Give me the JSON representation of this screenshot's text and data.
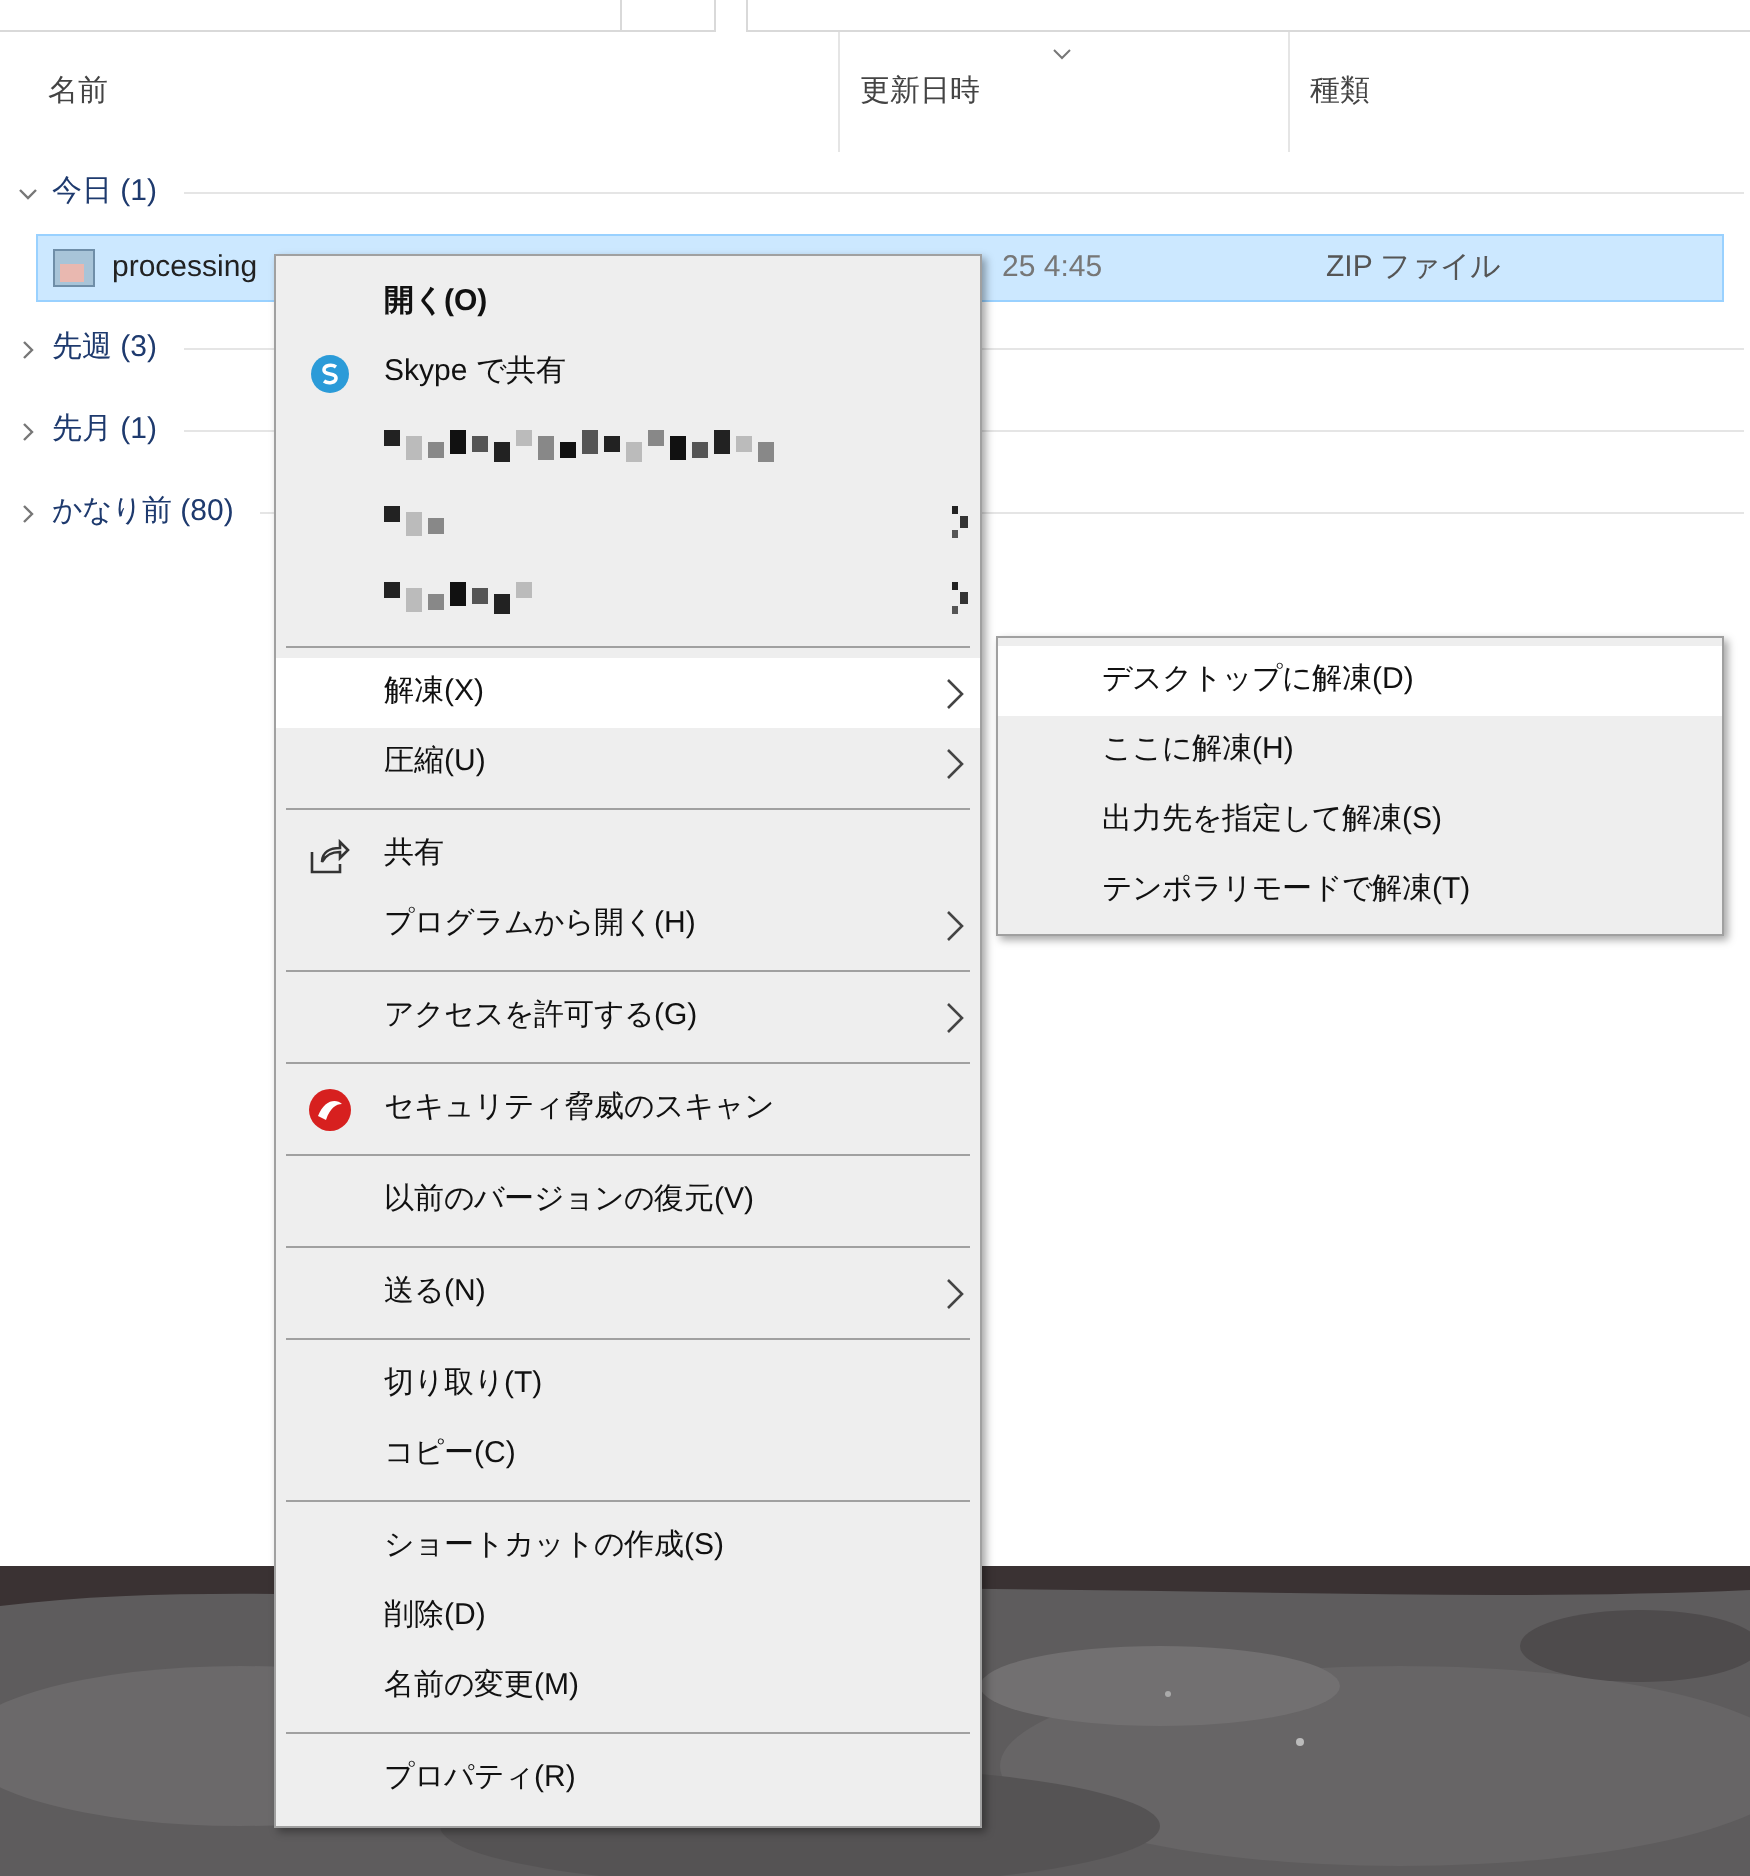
{
  "columns": [
    {
      "label": "名前",
      "sorted": false
    },
    {
      "label": "更新日時",
      "sorted": true
    },
    {
      "label": "種類",
      "sorted": false
    }
  ],
  "groups": [
    {
      "label": "今日 (1)",
      "expanded": true,
      "files": [
        {
          "name": "processing",
          "date": "25 4:45",
          "type": "ZIP ファイル",
          "selected": true
        }
      ]
    },
    {
      "label": "先週 (3)",
      "expanded": false
    },
    {
      "label": "先月 (1)",
      "expanded": false
    },
    {
      "label": "かなり前 (80)",
      "expanded": false
    }
  ],
  "context_menu": [
    {
      "kind": "item",
      "label": "開く(O)",
      "bold": true,
      "submenu": false,
      "selected": false
    },
    {
      "kind": "skype",
      "label": "Skype で共有",
      "submenu": false,
      "selected": false
    },
    {
      "kind": "redacted",
      "submenu": false
    },
    {
      "kind": "redacted",
      "submenu": true
    },
    {
      "kind": "redacted",
      "submenu": true
    },
    {
      "kind": "separator"
    },
    {
      "kind": "item",
      "label": "解凍(X)",
      "submenu": true,
      "selected": true
    },
    {
      "kind": "item",
      "label": "圧縮(U)",
      "submenu": true,
      "selected": false
    },
    {
      "kind": "separator"
    },
    {
      "kind": "share",
      "label": "共有",
      "submenu": false,
      "selected": false
    },
    {
      "kind": "item",
      "label": "プログラムから開く(H)",
      "submenu": true,
      "selected": false
    },
    {
      "kind": "separator"
    },
    {
      "kind": "item",
      "label": "アクセスを許可する(G)",
      "submenu": true,
      "selected": false
    },
    {
      "kind": "separator"
    },
    {
      "kind": "security",
      "label": "セキュリティ脅威のスキャン",
      "submenu": false,
      "selected": false
    },
    {
      "kind": "separator"
    },
    {
      "kind": "item",
      "label": "以前のバージョンの復元(V)",
      "submenu": false,
      "selected": false
    },
    {
      "kind": "separator"
    },
    {
      "kind": "item",
      "label": "送る(N)",
      "submenu": true,
      "selected": false
    },
    {
      "kind": "separator"
    },
    {
      "kind": "item",
      "label": "切り取り(T)",
      "submenu": false,
      "selected": false
    },
    {
      "kind": "item",
      "label": "コピー(C)",
      "submenu": false,
      "selected": false
    },
    {
      "kind": "separator"
    },
    {
      "kind": "item",
      "label": "ショートカットの作成(S)",
      "submenu": false,
      "selected": false
    },
    {
      "kind": "item",
      "label": "削除(D)",
      "submenu": false,
      "selected": false
    },
    {
      "kind": "item",
      "label": "名前の変更(M)",
      "submenu": false,
      "selected": false
    },
    {
      "kind": "separator"
    },
    {
      "kind": "item",
      "label": "プロパティ(R)",
      "submenu": false,
      "selected": false
    }
  ],
  "submenu": [
    {
      "label": "デスクトップに解凍(D)",
      "selected": true
    },
    {
      "label": "ここに解凍(H)",
      "selected": false
    },
    {
      "label": "出力先を指定して解凍(S)",
      "selected": false
    },
    {
      "label": "テンポラリモードで解凍(T)",
      "selected": false
    }
  ]
}
